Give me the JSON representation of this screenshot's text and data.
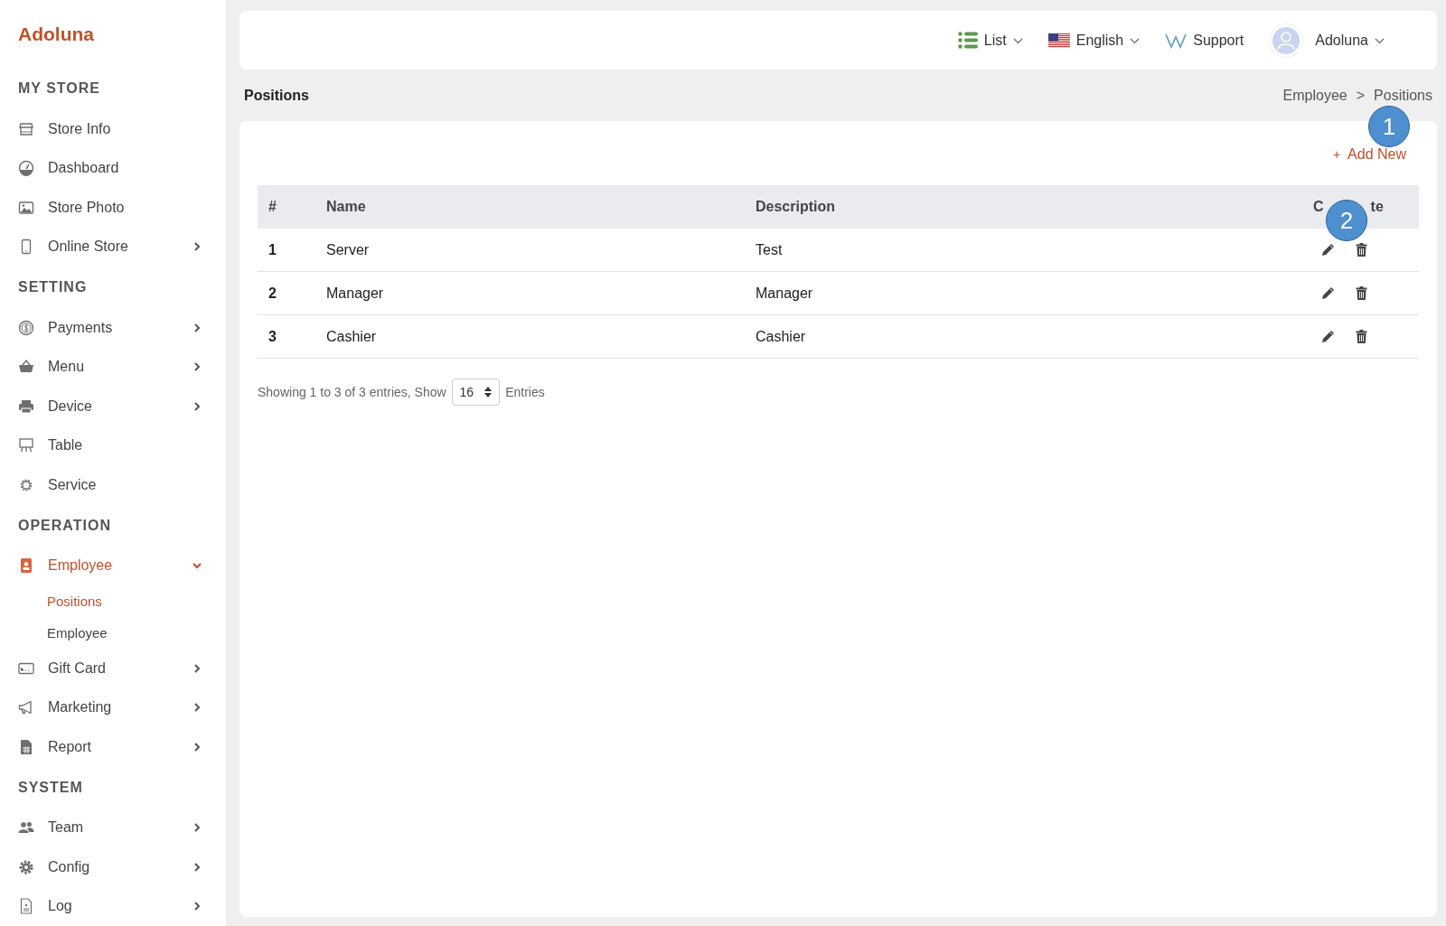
{
  "brand": "Adoluna",
  "sidebar": {
    "sections": [
      {
        "title": "MY STORE",
        "items": [
          {
            "label": "Store Info",
            "expandable": false,
            "expanded": false,
            "selected": false
          },
          {
            "label": "Dashboard",
            "expandable": false,
            "expanded": false,
            "selected": false
          },
          {
            "label": "Store Photo",
            "expandable": false,
            "expanded": false,
            "selected": false
          },
          {
            "label": "Online Store",
            "expandable": true,
            "expanded": false,
            "selected": false
          }
        ]
      },
      {
        "title": "SETTING",
        "items": [
          {
            "label": "Payments",
            "expandable": true,
            "expanded": false,
            "selected": false
          },
          {
            "label": "Menu",
            "expandable": true,
            "expanded": false,
            "selected": false
          },
          {
            "label": "Device",
            "expandable": true,
            "expanded": false,
            "selected": false
          },
          {
            "label": "Table",
            "expandable": false,
            "expanded": false,
            "selected": false
          },
          {
            "label": "Service",
            "expandable": false,
            "expanded": false,
            "selected": false
          }
        ]
      },
      {
        "title": "OPERATION",
        "items": [
          {
            "label": "Employee",
            "expandable": true,
            "expanded": true,
            "selected": true,
            "children": [
              {
                "label": "Positions",
                "selected": true
              },
              {
                "label": "Employee",
                "selected": false
              }
            ]
          },
          {
            "label": "Gift Card",
            "expandable": true,
            "expanded": false,
            "selected": false
          },
          {
            "label": "Marketing",
            "expandable": true,
            "expanded": false,
            "selected": false
          },
          {
            "label": "Report",
            "expandable": true,
            "expanded": false,
            "selected": false
          }
        ]
      },
      {
        "title": "SYSTEM",
        "items": [
          {
            "label": "Team",
            "expandable": true,
            "expanded": false,
            "selected": false
          },
          {
            "label": "Config",
            "expandable": true,
            "expanded": false,
            "selected": false
          },
          {
            "label": "Log",
            "expandable": true,
            "expanded": false,
            "selected": false
          }
        ]
      }
    ]
  },
  "topbar": {
    "view_menu": "List",
    "language": "English",
    "support": "Support",
    "user": "Adoluna"
  },
  "page_title": "Positions",
  "breadcrumb": [
    "Employee",
    ">",
    "Positions"
  ],
  "add_button": "Add New",
  "add_icon": "+",
  "table": {
    "columns": [
      "#",
      "Name",
      "Description"
    ],
    "column_4_fragments": [
      "C",
      "te"
    ],
    "rows": [
      {
        "number": "1",
        "name": "Server",
        "description": "Test"
      },
      {
        "number": "2",
        "name": "Manager",
        "description": "Manager"
      },
      {
        "number": "3",
        "name": "Cashier",
        "description": "Cashier"
      }
    ]
  },
  "footer": {
    "summary": "Showing 1 to 3 of 3 entries, Show",
    "page_size": "16",
    "suffix": "Entries"
  },
  "callouts": [
    {
      "label": "1"
    },
    {
      "label": "2"
    }
  ]
}
